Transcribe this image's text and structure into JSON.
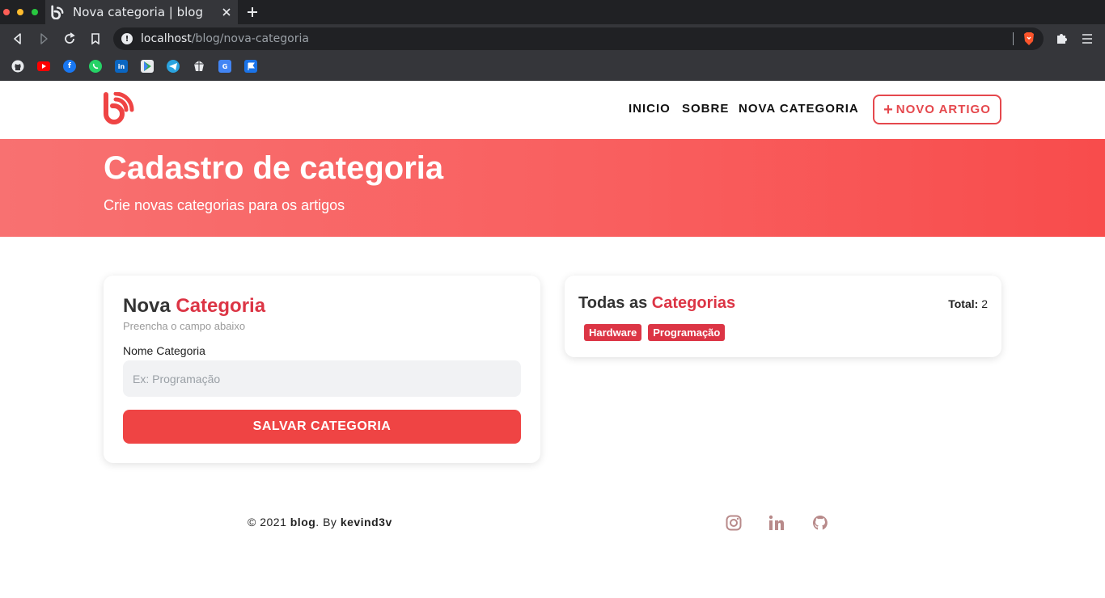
{
  "browser": {
    "tab_title": "Nova categoria | blog",
    "url_host": "localhost",
    "url_path": "/blog/nova-categoria",
    "bookmarks": [
      "github-icon",
      "youtube-icon",
      "facebook-icon",
      "whatsapp-icon",
      "linkedin-icon",
      "google-play-icon",
      "telegram-icon",
      "crystal-icon",
      "google-translate-icon",
      "flag-icon"
    ]
  },
  "nav": {
    "links": [
      "INICIO",
      "SOBRE",
      "NOVA CATEGORIA"
    ],
    "cta_plus": "+",
    "cta_label": "NOVO ARTIGO"
  },
  "hero": {
    "title": "Cadastro de categoria",
    "subtitle": "Crie novas categorias para os artigos"
  },
  "form": {
    "title_prefix": "Nova ",
    "title_accent": "Categoria",
    "hint": "Preencha o campo abaixo",
    "field_label": "Nome Categoria",
    "field_placeholder": "Ex: Programação",
    "field_value": "",
    "submit_label": "SALVAR CATEGORIA"
  },
  "categories": {
    "title_prefix": "Todas as ",
    "title_accent": "Categorias",
    "total_label": "Total:",
    "total_value": "2",
    "items": [
      "Hardware",
      "Programação"
    ]
  },
  "footer": {
    "copy_prefix": "© 2021 ",
    "brand": "blog",
    "by": ". By ",
    "author": "kevind3v",
    "social": [
      "instagram-icon",
      "linkedin-icon",
      "github-icon"
    ]
  },
  "colors": {
    "accent": "#dc3545",
    "button": "#ef4444",
    "hero_start": "#f87171",
    "hero_end": "#f84c4c",
    "social_icon": "#b88a8a"
  }
}
